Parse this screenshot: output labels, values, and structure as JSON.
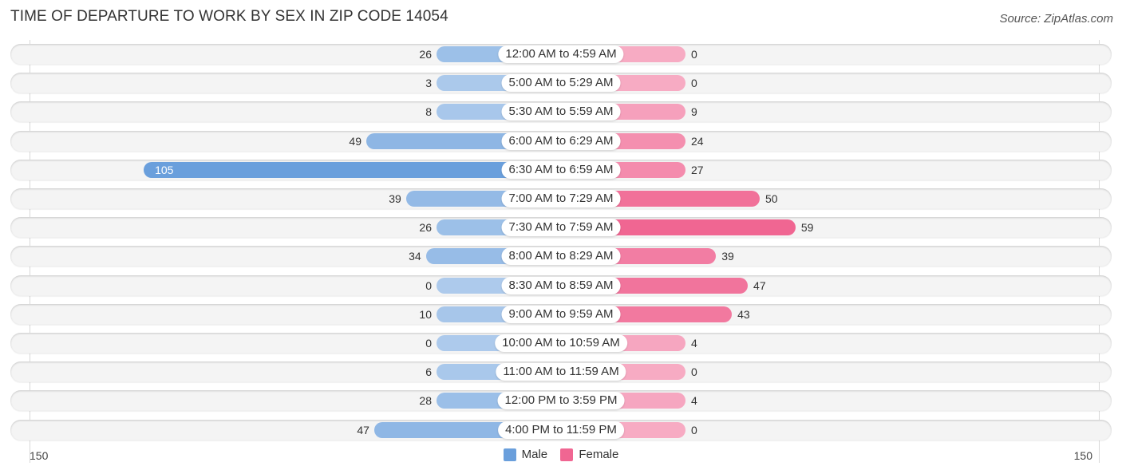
{
  "chart_data": {
    "type": "bar",
    "orientation": "horizontal-butterfly",
    "title": "TIME OF DEPARTURE TO WORK BY SEX IN ZIP CODE 14054",
    "source": "Source: ZipAtlas.com",
    "categories": [
      "12:00 AM to 4:59 AM",
      "5:00 AM to 5:29 AM",
      "5:30 AM to 5:59 AM",
      "6:00 AM to 6:29 AM",
      "6:30 AM to 6:59 AM",
      "7:00 AM to 7:29 AM",
      "7:30 AM to 7:59 AM",
      "8:00 AM to 8:29 AM",
      "8:30 AM to 8:59 AM",
      "9:00 AM to 9:59 AM",
      "10:00 AM to 10:59 AM",
      "11:00 AM to 11:59 AM",
      "12:00 PM to 3:59 PM",
      "4:00 PM to 11:59 PM"
    ],
    "series": [
      {
        "name": "Male",
        "color": "#6a9fdc",
        "values": [
          26,
          3,
          8,
          49,
          105,
          39,
          26,
          34,
          0,
          10,
          0,
          6,
          28,
          47
        ]
      },
      {
        "name": "Female",
        "color": "#f06692",
        "values": [
          0,
          0,
          9,
          24,
          27,
          50,
          59,
          39,
          47,
          43,
          4,
          0,
          4,
          0
        ]
      }
    ],
    "axis": {
      "left_label": "150",
      "right_label": "150",
      "range": [
        0,
        150
      ]
    },
    "legend": {
      "position": "bottom-center",
      "items": [
        "Male",
        "Female"
      ]
    }
  }
}
